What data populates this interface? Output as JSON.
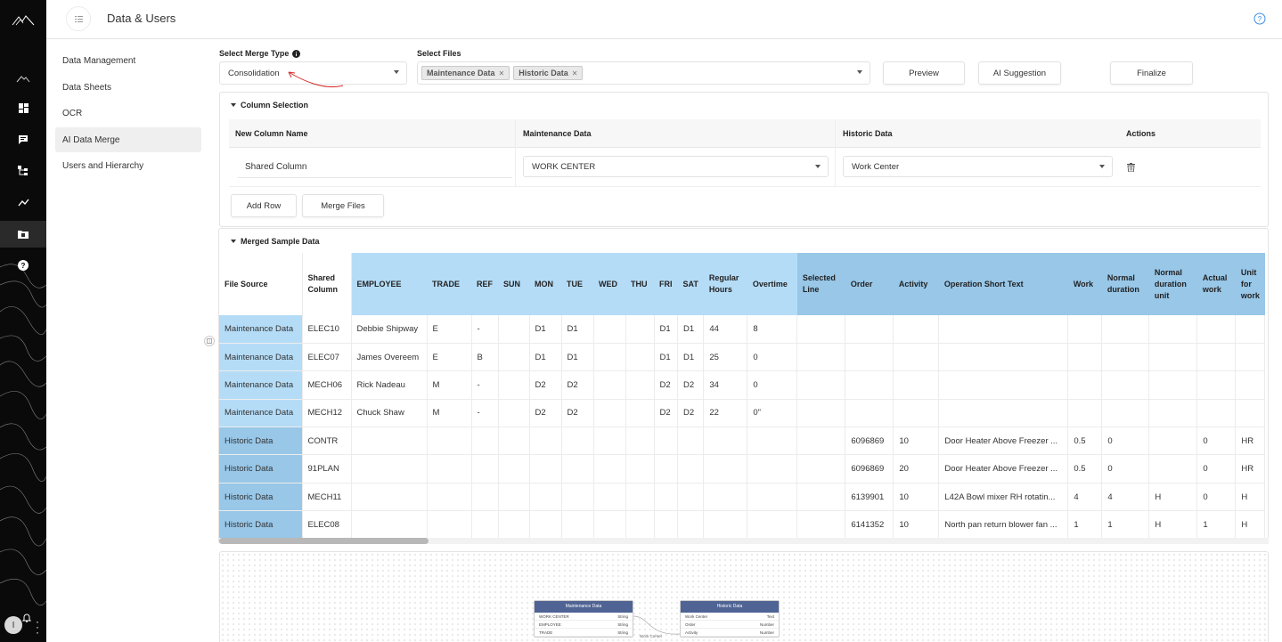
{
  "header": {
    "title": "Data & Users"
  },
  "sidenav": {
    "items": [
      {
        "label": "Data Management"
      },
      {
        "label": "Data Sheets"
      },
      {
        "label": "OCR"
      },
      {
        "label": "AI Data Merge"
      },
      {
        "label": "Users and Hierarchy"
      }
    ]
  },
  "rail": {
    "avatar_initial": "I",
    "icons": [
      "mountain-icon",
      "dashboard-icon",
      "chat-icon",
      "hierarchy-icon",
      "trend-icon",
      "data-merge-icon",
      "help-icon"
    ]
  },
  "controls": {
    "merge_type_label": "Select Merge Type",
    "merge_type_value": "Consolidation",
    "files_label": "Select Files",
    "files": [
      "Maintenance Data",
      "Historic Data"
    ],
    "preview": "Preview",
    "ai_suggestion": "AI Suggestion",
    "finalize": "Finalize"
  },
  "column_selection": {
    "title": "Column Selection",
    "headers": [
      "New Column Name",
      "Maintenance Data",
      "Historic Data",
      "Actions"
    ],
    "row": {
      "new_name": "Shared Column",
      "maintenance": "WORK CENTER",
      "historic": "Work Center"
    },
    "add_row": "Add Row",
    "merge_files": "Merge Files"
  },
  "merged": {
    "title": "Merged Sample Data",
    "headers": [
      "File Source",
      "Shared Column",
      "EMPLOYEE",
      "TRADE",
      "REF",
      "SUN",
      "MON",
      "TUE",
      "WED",
      "THU",
      "FRI",
      "SAT",
      "Regular Hours",
      "Overtime",
      "Selected Line",
      "Order",
      "Activity",
      "Operation Short Text",
      "Work",
      "Normal duration",
      "Normal duration unit",
      "Actual work",
      "Unit for work"
    ],
    "rows": [
      [
        "Maintenance Data",
        "ELEC10",
        "Debbie Shipway",
        "E",
        "-",
        "",
        "D1",
        "D1",
        "",
        "",
        "D1",
        "D1",
        "44",
        "8",
        "",
        "",
        "",
        "",
        "",
        "",
        "",
        "",
        ""
      ],
      [
        "Maintenance Data",
        "ELEC07",
        "James Overeem",
        "E",
        "B",
        "",
        "D1",
        "D1",
        "",
        "",
        "D1",
        "D1",
        "25",
        "0",
        "",
        "",
        "",
        "",
        "",
        "",
        "",
        "",
        ""
      ],
      [
        "Maintenance Data",
        "MECH06",
        "Rick Nadeau",
        "M",
        "-",
        "",
        "D2",
        "D2",
        "",
        "",
        "D2",
        "D2",
        "34",
        "0",
        "",
        "",
        "",
        "",
        "",
        "",
        "",
        "",
        ""
      ],
      [
        "Maintenance Data",
        "MECH12",
        "Chuck Shaw",
        "M",
        "-",
        "",
        "D2",
        "D2",
        "",
        "",
        "D2",
        "D2",
        "22",
        "0\"",
        "",
        "",
        "",
        "",
        "",
        "",
        "",
        "",
        ""
      ],
      [
        "Historic Data",
        "CONTR",
        "",
        "",
        "",
        "",
        "",
        "",
        "",
        "",
        "",
        "",
        "",
        "",
        "",
        "6096869",
        "10",
        "Door Heater Above Freezer ...",
        "0.5",
        "0",
        "",
        "0",
        "HR"
      ],
      [
        "Historic Data",
        "91PLAN",
        "",
        "",
        "",
        "",
        "",
        "",
        "",
        "",
        "",
        "",
        "",
        "",
        "",
        "6096869",
        "20",
        "Door Heater Above Freezer ...",
        "0.5",
        "0",
        "",
        "0",
        "HR"
      ],
      [
        "Historic Data",
        "MECH11",
        "",
        "",
        "",
        "",
        "",
        "",
        "",
        "",
        "",
        "",
        "",
        "",
        "",
        "6139901",
        "10",
        "L42A Bowl mixer RH rotatin...",
        "4",
        "4",
        "H",
        "0",
        "H"
      ],
      [
        "Historic Data",
        "ELEC08",
        "",
        "",
        "",
        "",
        "",
        "",
        "",
        "",
        "",
        "",
        "",
        "",
        "",
        "6141352",
        "10",
        "North pan return blower fan ...",
        "1",
        "1",
        "H",
        "1",
        "H"
      ]
    ]
  },
  "diagram": {
    "nodes": [
      {
        "title": "Maintenance Data",
        "rows": [
          [
            "WORK CENTER",
            "String"
          ],
          [
            "EMPLOYEE",
            "String"
          ],
          [
            "TRADE",
            "String"
          ]
        ]
      },
      {
        "title": "Historic Data",
        "rows": [
          [
            "Work Center",
            "Text"
          ],
          [
            "Order",
            "Number"
          ],
          [
            "Activity",
            "Number"
          ]
        ]
      }
    ],
    "link_label": "Work Center"
  }
}
